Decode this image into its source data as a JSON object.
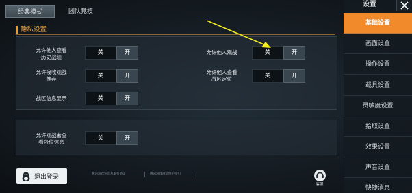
{
  "tabs": [
    {
      "label": "经典模式",
      "active": true
    },
    {
      "label": "团队竞技",
      "active": false
    }
  ],
  "section": {
    "title": "隐私设置"
  },
  "settings": [
    {
      "label_l1": "允许他人查看",
      "label_l2": "历史战绩",
      "off": "关",
      "on": "开"
    },
    {
      "label_l1": "允许他人观战",
      "label_l2": "",
      "off": "关",
      "on": "开"
    },
    {
      "label_l1": "允许接收观战",
      "label_l2": "推荐",
      "off": "关",
      "on": "开"
    },
    {
      "label_l1": "允许他人查看",
      "label_l2": "战区定位",
      "off": "关",
      "on": "开"
    },
    {
      "label_l1": "战区信息显示",
      "label_l2": "",
      "off": "关",
      "on": "开"
    },
    {
      "label_l1": "允许观战者查",
      "label_l2": "看段位信息",
      "off": "关",
      "on": "开"
    }
  ],
  "footer": {
    "logout": "退出登录",
    "link1": "腾讯游戏许可及服务协议",
    "link2": "腾讯游戏隐私保护指引",
    "service": "客服"
  },
  "sidebar": {
    "title": "设置",
    "items": [
      "基础设置",
      "画面设置",
      "操作设置",
      "载具设置",
      "灵敏度设置",
      "拾取设置",
      "效果设置",
      "声音设置",
      "快捷消息"
    ],
    "active_index": 0
  },
  "colors": {
    "accent": "#f08a2a",
    "section_title": "#f2a845",
    "annotation_arrow": "#f4ef1e"
  }
}
